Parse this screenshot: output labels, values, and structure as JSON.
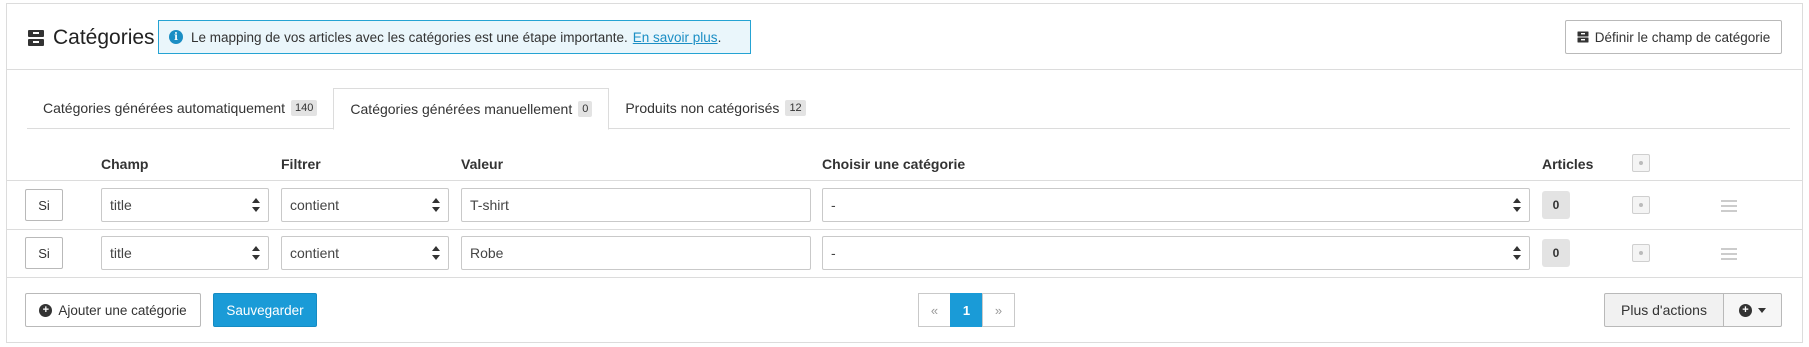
{
  "header": {
    "title": "Catégories",
    "info_text": "Le mapping de vos articles avec les catégories est une étape importante.",
    "info_link": "En savoir plus",
    "info_suffix": ".",
    "define_button": "Définir le champ de catégorie"
  },
  "tabs": [
    {
      "label": "Catégories générées automatiquement",
      "count": "140",
      "active": false
    },
    {
      "label": "Catégories générées manuellement",
      "count": "0",
      "active": true
    },
    {
      "label": "Produits non catégorisés",
      "count": "12",
      "active": false
    }
  ],
  "columns": {
    "champ": "Champ",
    "filtrer": "Filtrer",
    "valeur": "Valeur",
    "categorie": "Choisir une catégorie",
    "articles": "Articles"
  },
  "rows": [
    {
      "condition": "Si",
      "champ": "title",
      "filtre": "contient",
      "valeur": "T-shirt",
      "categorie": "-",
      "articles": "0"
    },
    {
      "condition": "Si",
      "champ": "title",
      "filtre": "contient",
      "valeur": "Robe",
      "categorie": "-",
      "articles": "0"
    }
  ],
  "footer": {
    "add_button": "Ajouter une catégorie",
    "save_button": "Sauvegarder",
    "pagination": {
      "prev": "«",
      "current": "1",
      "next": "»"
    },
    "more_actions": "Plus d'actions"
  },
  "colors": {
    "accent": "#1a9bd7",
    "info_border": "#25a3d3",
    "info_bg": "#eaf6fb"
  },
  "icons": [
    "archive-icon",
    "info-icon",
    "select-arrows-icon",
    "checkbox-icon",
    "drag-handle-icon",
    "plus-circle-icon",
    "caret-down-icon"
  ]
}
